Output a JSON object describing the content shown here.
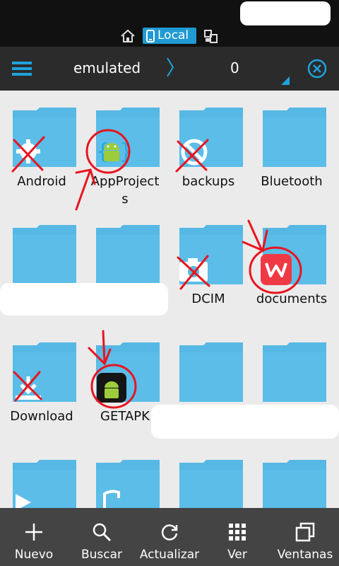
{
  "header": {
    "segments": [
      {
        "name": "home"
      },
      {
        "name": "local",
        "label": "Local"
      },
      {
        "name": "network"
      }
    ]
  },
  "path": {
    "current": "emulated",
    "next": "0"
  },
  "files": [
    {
      "label": "Android",
      "icon": "gear-icon"
    },
    {
      "label": "AppProjects",
      "label_lines": [
        "AppProject",
        "s"
      ],
      "icon": "android-icon"
    },
    {
      "label": "backups",
      "icon": "no-entry-icon"
    },
    {
      "label": "Bluetooth",
      "icon": "folder-icon"
    },
    {
      "label": "",
      "icon": "folder-icon"
    },
    {
      "label": "",
      "icon": "folder-icon"
    },
    {
      "label": "DCIM",
      "icon": "camera-icon"
    },
    {
      "label": "documents",
      "icon": "wps-office-icon"
    },
    {
      "label": "Download",
      "icon": "download-icon"
    },
    {
      "label": "GETAPK",
      "icon": "android-app-icon"
    },
    {
      "label": "",
      "icon": "folder-icon"
    },
    {
      "label": "",
      "icon": "folder-icon"
    },
    {
      "label": "",
      "icon": "folder-icon"
    },
    {
      "label": "",
      "icon": "folder-icon"
    },
    {
      "label": "",
      "icon": "folder-icon"
    },
    {
      "label": "",
      "icon": "folder-icon"
    }
  ],
  "bottom_bar": [
    {
      "label": "Nuevo",
      "icon": "plus-icon"
    },
    {
      "label": "Buscar",
      "icon": "search-icon"
    },
    {
      "label": "Actualizar",
      "icon": "refresh-icon"
    },
    {
      "label": "Ver",
      "icon": "grid-icon"
    },
    {
      "label": "Ventanas",
      "icon": "windows-icon"
    }
  ],
  "colors": {
    "accent": "#1f9ad3",
    "folder": "#56b8e4",
    "folder_tab": "#66c4ee",
    "annotation": "#e8141f"
  }
}
